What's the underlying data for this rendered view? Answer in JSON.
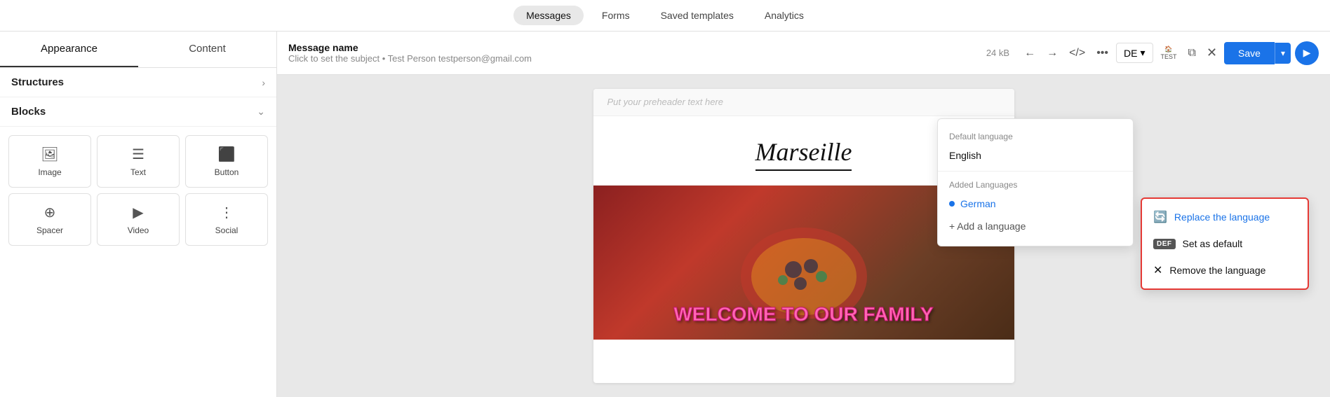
{
  "nav": {
    "tabs": [
      {
        "label": "Messages",
        "active": true
      },
      {
        "label": "Forms",
        "active": false
      },
      {
        "label": "Saved templates",
        "active": false
      },
      {
        "label": "Analytics",
        "active": false
      }
    ]
  },
  "sidebar": {
    "tab_appearance": "Appearance",
    "tab_content": "Content",
    "structures_label": "Structures",
    "blocks_label": "Blocks",
    "blocks": [
      {
        "label": "Image",
        "icon": "🖼"
      },
      {
        "label": "Text",
        "icon": "☰"
      },
      {
        "label": "Button",
        "icon": "⬛"
      },
      {
        "label": "Spacer",
        "icon": "⊕"
      },
      {
        "label": "Video",
        "icon": "▶"
      },
      {
        "label": "Social",
        "icon": "⋮"
      }
    ]
  },
  "toolbar": {
    "message_name": "Message name",
    "subject_label": "Click to set the subject",
    "recipient": "• Test Person testperson@gmail.com",
    "file_size": "24 kB",
    "lang_code": "DE",
    "save_label": "Save",
    "test_label": "TEST"
  },
  "canvas": {
    "preheader_placeholder": "Put your preheader text here",
    "email_title": "Marseille",
    "welcome_text": "WELCOME TO OUR FAMILY"
  },
  "lang_dropdown": {
    "default_language_label": "Default language",
    "default_language": "English",
    "added_languages_label": "Added Languages",
    "german_label": "German",
    "add_language_label": "+ Add a language"
  },
  "context_menu": {
    "replace_label": "Replace the language",
    "default_label": "Set as default",
    "remove_label": "Remove the language",
    "def_badge": "DEF"
  }
}
